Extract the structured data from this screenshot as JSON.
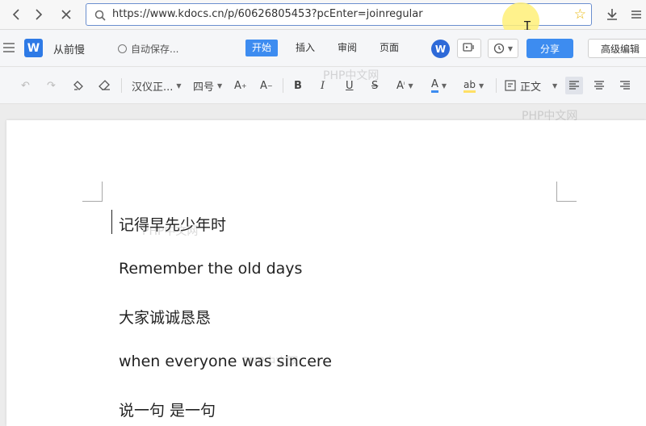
{
  "browser": {
    "url": "https://www.kdocs.cn/p/60626805453?pcEnter=joinregular"
  },
  "app": {
    "doc_title": "从前慢",
    "autosave": "自动保存...",
    "tabs": [
      {
        "label": "开始",
        "active": true
      },
      {
        "label": "插入",
        "active": false
      },
      {
        "label": "审阅",
        "active": false
      },
      {
        "label": "页面",
        "active": false
      }
    ],
    "share_label": "分享",
    "advanced_label": "高级编辑",
    "logo_letter": "W"
  },
  "format": {
    "font_name": "汉仪正...",
    "font_size": "四号",
    "style": "正文"
  },
  "watermark": "PHP中文网",
  "document": {
    "lines": [
      "记得早先少年时",
      "Remember the old days",
      "大家诚诚恳恳",
      "when everyone was sincere",
      "说一句  是一句"
    ]
  },
  "colors": {
    "accent": "#3d8cf0",
    "logo": "#2e7ae6",
    "highlight": "#ffe066"
  }
}
